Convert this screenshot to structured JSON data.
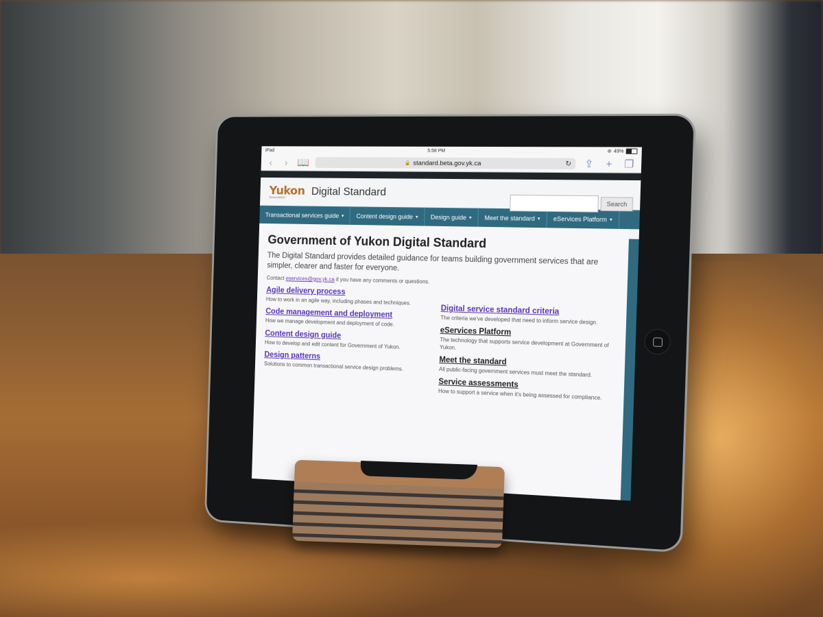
{
  "status_bar": {
    "device": "iPad",
    "time": "5:58 PM",
    "battery_percent": "49%",
    "battery_level": 0.49
  },
  "browser": {
    "url": "standard.beta.gov.yk.ca",
    "icons": {
      "back": "chevron-left-icon",
      "forward": "chevron-right-icon",
      "bookmarks": "book-icon",
      "lock": "lock-icon",
      "reload": "reload-icon",
      "share": "share-icon",
      "new_tab": "plus-icon",
      "tabs": "tabs-icon"
    }
  },
  "site": {
    "logo_text": "Yukon",
    "logo_subtext": "Government",
    "title": "Digital Standard",
    "search_placeholder": "",
    "search_button": "Search",
    "brand_color": "#b6732a",
    "nav_color": "#2f6a80",
    "nav": [
      {
        "label": "Transactional services guide"
      },
      {
        "label": "Content design guide"
      },
      {
        "label": "Design guide"
      },
      {
        "label": "Meet the standard"
      },
      {
        "label": "eServices Platform"
      }
    ]
  },
  "page": {
    "heading": "Government of Yukon Digital Standard",
    "lead": "The Digital Standard provides detailed guidance for teams building government services that are simpler, clearer and faster for everyone.",
    "contact_prefix": "Contact",
    "contact_email": "eservices@gov.yk.ca",
    "contact_suffix": "if you have any comments or questions.",
    "left_links": [
      {
        "title": "Agile delivery process",
        "desc": "How to work in an agile way, including phases and techniques."
      },
      {
        "title": "Code management and deployment",
        "desc": "How we manage development and deployment of code."
      },
      {
        "title": "Content design guide",
        "desc": "How to develop and edit content for Government of Yukon."
      },
      {
        "title": "Design patterns",
        "desc": "Solutions to common transactional service design problems."
      }
    ],
    "right_links": [
      {
        "title": "Digital service standard criteria",
        "desc": "The criteria we've developed that need to inform service design."
      },
      {
        "title": "eServices Platform",
        "desc": "The technology that supports service development at Government of Yukon."
      },
      {
        "title": "Meet the standard",
        "desc": "All public-facing government services must meet the standard."
      },
      {
        "title": "Service assessments",
        "desc": "How to support a service when it's being assessed for compliance."
      }
    ]
  }
}
